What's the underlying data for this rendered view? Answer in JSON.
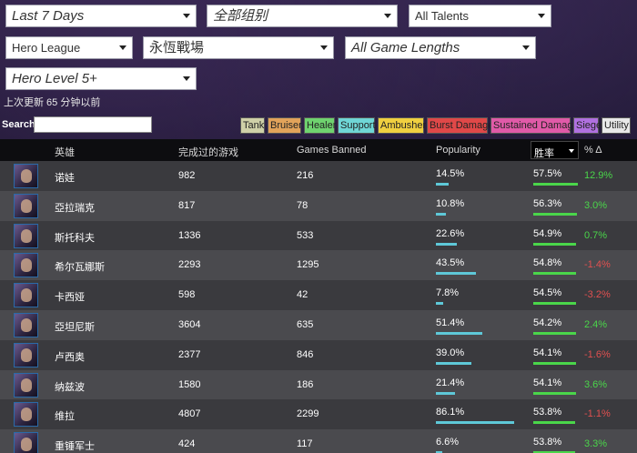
{
  "filters": {
    "time_range": "Last 7 Days",
    "group": "全部组别",
    "talents": "All Talents",
    "game_mode": "Hero League",
    "map": "永恆戰場",
    "game_length": "All Game Lengths",
    "hero_level": "Hero Level 5+"
  },
  "updated_text": "上次更新 65 分钟以前",
  "search": {
    "label": "Search:",
    "value": ""
  },
  "roles": [
    {
      "label": "Tank",
      "color": "#cfd0a8"
    },
    {
      "label": "Bruiser",
      "color": "#e2a35a"
    },
    {
      "label": "Healer",
      "color": "#6fd36f"
    },
    {
      "label": "Support",
      "color": "#6fd6d6"
    },
    {
      "label": "Ambusher",
      "color": "#f0d040"
    },
    {
      "label": "Burst Damage",
      "color": "#e04848"
    },
    {
      "label": "Sustained Damage",
      "color": "#e05aa8"
    },
    {
      "label": "Siege",
      "color": "#b070e0"
    },
    {
      "label": "Utility",
      "color": "#e8e8e8"
    }
  ],
  "table": {
    "headers": {
      "hero": "英雄",
      "games_played": "完成过的游戏",
      "games_banned": "Games Banned",
      "popularity": "Popularity",
      "win_rate": "胜率",
      "delta": "% Δ"
    },
    "colors": {
      "popularity_bar": "#5ec8d8",
      "winrate_bar": "#4ad64a",
      "delta_positive": "#4ad64a",
      "delta_negative": "#e05050"
    },
    "rows": [
      {
        "hero": "诺娃",
        "games": "982",
        "banned": "216",
        "popularity": "14.5%",
        "pop_value": 14.5,
        "winrate": "57.5%",
        "win_value": 57.5,
        "delta": "12.9%",
        "positive": true
      },
      {
        "hero": "亞拉瑞克",
        "games": "817",
        "banned": "78",
        "popularity": "10.8%",
        "pop_value": 10.8,
        "winrate": "56.3%",
        "win_value": 56.3,
        "delta": "3.0%",
        "positive": true
      },
      {
        "hero": "斯托科夫",
        "games": "1336",
        "banned": "533",
        "popularity": "22.6%",
        "pop_value": 22.6,
        "winrate": "54.9%",
        "win_value": 54.9,
        "delta": "0.7%",
        "positive": true
      },
      {
        "hero": "希尔瓦娜斯",
        "games": "2293",
        "banned": "1295",
        "popularity": "43.5%",
        "pop_value": 43.5,
        "winrate": "54.8%",
        "win_value": 54.8,
        "delta": "-1.4%",
        "positive": false
      },
      {
        "hero": "卡西娅",
        "games": "598",
        "banned": "42",
        "popularity": "7.8%",
        "pop_value": 7.8,
        "winrate": "54.5%",
        "win_value": 54.5,
        "delta": "-3.2%",
        "positive": false
      },
      {
        "hero": "亞坦尼斯",
        "games": "3604",
        "banned": "635",
        "popularity": "51.4%",
        "pop_value": 51.4,
        "winrate": "54.2%",
        "win_value": 54.2,
        "delta": "2.4%",
        "positive": true
      },
      {
        "hero": "卢西奥",
        "games": "2377",
        "banned": "846",
        "popularity": "39.0%",
        "pop_value": 39.0,
        "winrate": "54.1%",
        "win_value": 54.1,
        "delta": "-1.6%",
        "positive": false
      },
      {
        "hero": "纳兹波",
        "games": "1580",
        "banned": "186",
        "popularity": "21.4%",
        "pop_value": 21.4,
        "winrate": "54.1%",
        "win_value": 54.1,
        "delta": "3.6%",
        "positive": true
      },
      {
        "hero": "维拉",
        "games": "4807",
        "banned": "2299",
        "popularity": "86.1%",
        "pop_value": 86.1,
        "winrate": "53.8%",
        "win_value": 53.8,
        "delta": "-1.1%",
        "positive": false
      },
      {
        "hero": "重锤军士",
        "games": "424",
        "banned": "117",
        "popularity": "6.6%",
        "pop_value": 6.6,
        "winrate": "53.8%",
        "win_value": 53.8,
        "delta": "3.3%",
        "positive": true
      }
    ]
  }
}
